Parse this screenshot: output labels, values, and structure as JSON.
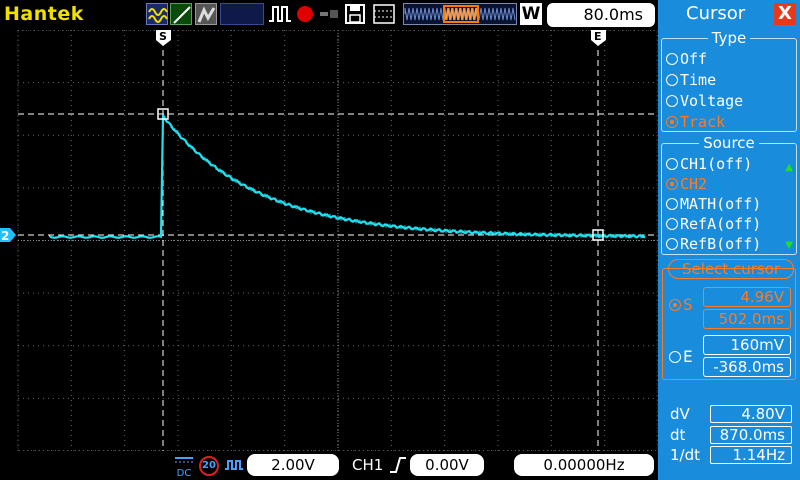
{
  "brand": "Hantek",
  "topbar": {
    "mode_letter": "W",
    "timebase": "80.0ms"
  },
  "bottombar": {
    "coupling": "DC",
    "bandwidth_limit": "20",
    "volts_per_div": "2.00V",
    "trigger_source": "CH1",
    "trigger_level": "0.00V",
    "frequency": "0.00000Hz"
  },
  "scope": {
    "channel_marker": "2",
    "cursor_start_label": "S",
    "cursor_end_label": "E"
  },
  "panel": {
    "title": "Cursor",
    "close_label": "X",
    "type_group": {
      "title": "Type",
      "options": [
        "Off",
        "Time",
        "Voltage",
        "Track"
      ],
      "selected": "Track"
    },
    "source_group": {
      "title": "Source",
      "options": [
        "CH1(off)",
        "CH2",
        "MATH(off)",
        "RefA(off)",
        "RefB(off)"
      ],
      "selected": "CH2"
    },
    "select_cursor": {
      "title": "Select cursor",
      "s_label": "S",
      "s_voltage": "4.96V",
      "s_time": "502.0ms",
      "e_label": "E",
      "e_voltage": "160mV",
      "e_time": "-368.0ms",
      "selected": "S"
    },
    "measurements": {
      "dv_label": "dV",
      "dv_value": "4.80V",
      "dt_label": "dt",
      "dt_value": "870.0ms",
      "inv_dt_label": "1/dt",
      "inv_dt_value": "1.14Hz"
    }
  },
  "colors": {
    "trace": "#20e0f0",
    "brand": "#f0e000",
    "accent": "#ff7a20",
    "panel_bg": "#1a8cdc"
  }
}
